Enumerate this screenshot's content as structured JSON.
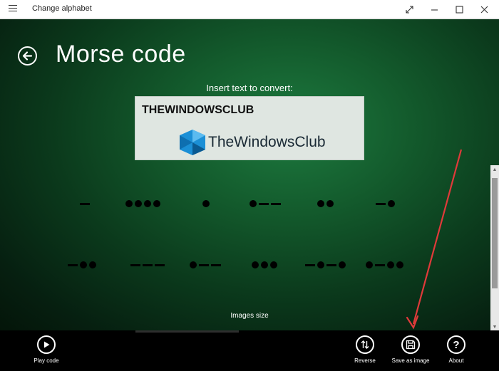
{
  "window": {
    "title": "Change alphabet",
    "controls": [
      "expand",
      "minimize",
      "maximize",
      "close"
    ]
  },
  "page": {
    "title": "Morse code",
    "insert_label": "Insert text to convert:",
    "input_value": "THEWINDOWSCLUB",
    "logo_text": "TheWindowsClub",
    "images_size_label": "Images size"
  },
  "morse": {
    "row1": [
      "-",
      "....",
      ".",
      ".--",
      "..",
      "-."
    ],
    "row2": [
      "-..",
      "---",
      ".--",
      "...",
      "-.-.",
      ".-.."
    ]
  },
  "commands": {
    "play": "Play code",
    "reverse": "Reverse",
    "save": "Save as image",
    "about": "About"
  },
  "colors": {
    "background_green": "#135a2c",
    "annotation_arrow": "#e03a3a"
  }
}
